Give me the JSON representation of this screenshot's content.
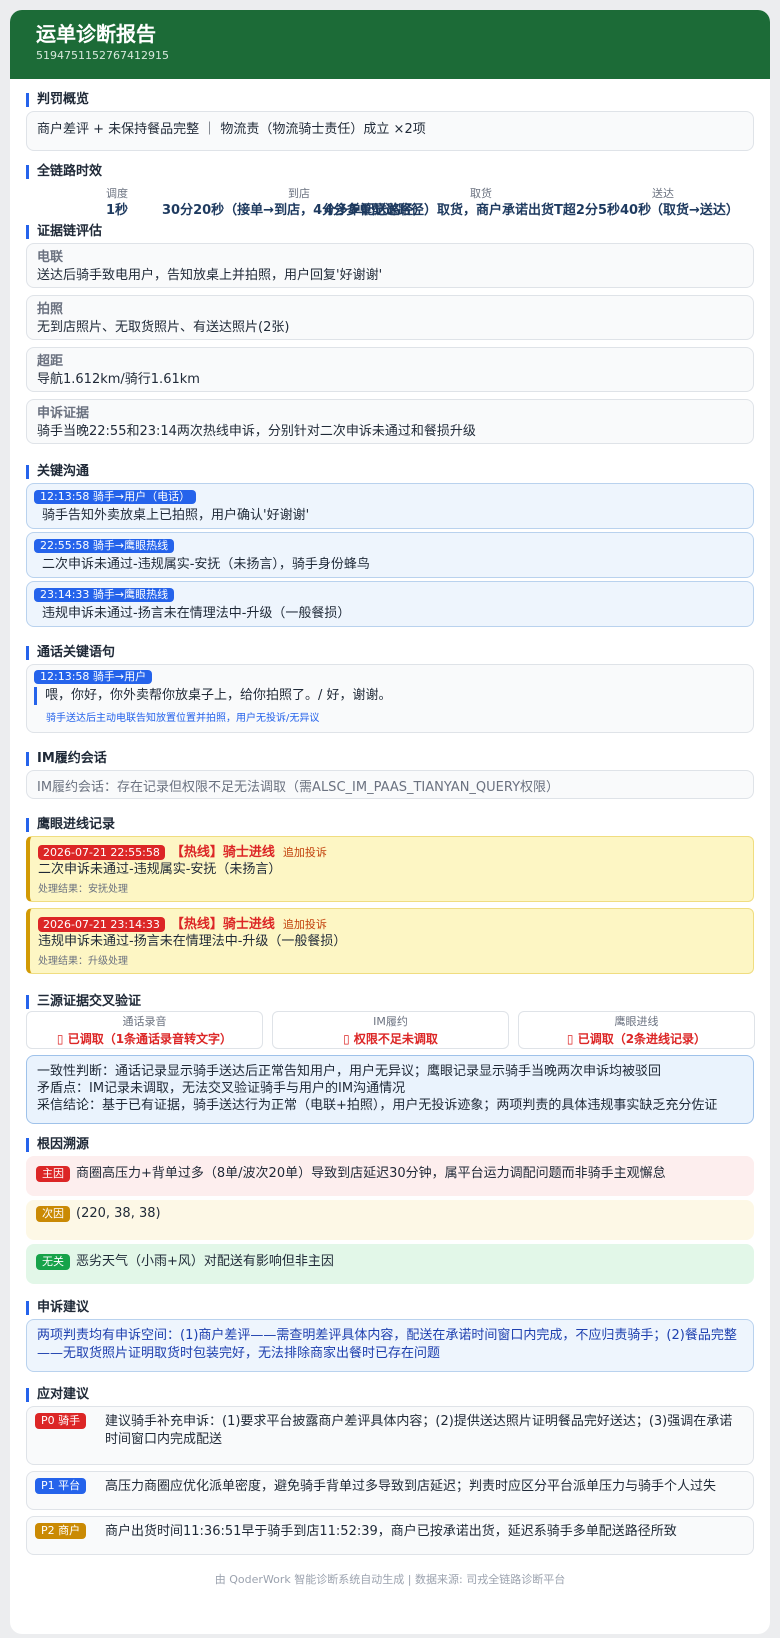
{
  "header": {
    "title": "运单诊断报告",
    "order_id": "5194751152767412915"
  },
  "penalty": {
    "title": "判罚概览",
    "text": "商户差评 + 未保持餐品完整 ｜ 物流责（物流骑士责任）成立 ×2项"
  },
  "timing": {
    "title": "全链路时效",
    "stages": [
      {
        "label": "调度",
        "value": "1秒"
      },
      {
        "label": "到店",
        "value": "30分20秒（接单→到店，4分多单配送路径）"
      },
      {
        "label": "取货",
        "value": "4分多单配送路径）取货，商户承诺出货T超2分5秒40秒"
      },
      {
        "label": "送达",
        "value": "（取货→送达）"
      }
    ]
  },
  "evidence": {
    "title": "证据链评估",
    "items": [
      {
        "label": "电联",
        "text": "送达后骑手致电用户，告知放桌上并拍照，用户回复'好谢谢'"
      },
      {
        "label": "拍照",
        "text": "无到店照片、无取货照片、有送达照片(2张)"
      },
      {
        "label": "超距",
        "text": "导航1.612km/骑行1.61km"
      },
      {
        "label": "申诉证据",
        "text": "骑手当晚22:55和23:14两次热线申诉，分别针对二次申诉未通过和餐损升级"
      }
    ]
  },
  "comms": {
    "title": "关键沟通",
    "items": [
      {
        "tag": "12:13:58  骑手→用户（电话）",
        "text": "骑手告知外卖放桌上已拍照，用户确认'好谢谢'"
      },
      {
        "tag": "22:55:58  骑手→鹰眼热线",
        "text": "二次申诉未通过-违规属实-安抚（未扬言），骑手身份蜂鸟"
      },
      {
        "tag": "23:14:33  骑手→鹰眼热线",
        "text": "违规申诉未通过-扬言未在情理法中-升级（一般餐损）"
      }
    ]
  },
  "call": {
    "title": "通话关键语句",
    "tag": "12:13:58  骑手→用户",
    "quote": "喂，你好，你外卖帮你放桌子上，给你拍照了。/ 好，谢谢。",
    "note": "骑手送达后主动电联告知放置位置并拍照，用户无投诉/无异议"
  },
  "im": {
    "title": "IM履约会话",
    "text": "IM履约会话：存在记录但权限不足无法调取（需ALSC_IM_PAAS_TIANYAN_QUERY权限）"
  },
  "eagle": {
    "title": "鹰眼进线记录",
    "items": [
      {
        "time": "2026-07-21 22:55:58",
        "type": "【热线】骑士进线",
        "extra": "追加投诉",
        "text": "二次申诉未通过-违规属实-安抚（未扬言）",
        "result": "处理结果：安抚处理"
      },
      {
        "time": "2026-07-21 23:14:33",
        "type": "【热线】骑士进线",
        "extra": "追加投诉",
        "text": "违规申诉未通过-扬言未在情理法中-升级（一般餐损）",
        "result": "处理结果：升级处理"
      }
    ]
  },
  "cross": {
    "title": "三源证据交叉验证",
    "sources": [
      {
        "label": "通话录音",
        "value": "▯ 已调取（1条通话录音转文字）"
      },
      {
        "label": "IM履约",
        "value": "▯ 权限不足未调取"
      },
      {
        "label": "鹰眼进线",
        "value": "▯ 已调取（2条进线记录）"
      }
    ],
    "lines": [
      "一致性判断：通话记录显示骑手送达后正常告知用户，用户无异议；鹰眼记录显示骑手当晚两次申诉均被驳回",
      "矛盾点：IM记录未调取，无法交叉验证骑手与用户的IM沟通情况",
      "采信结论：基于已有证据，骑手送达行为正常（电联+拍照），用户无投诉迹象；两项判责的具体违规事实缺乏充分佐证"
    ]
  },
  "root": {
    "title": "根因溯源",
    "items": [
      {
        "tag": "主因",
        "text": "商圈高压力+背单过多（8单/波次20单）导致到店延迟30分钟，属平台运力调配问题而非骑手主观懈怠",
        "color": "#dc2626",
        "bg": "#fdeeee"
      },
      {
        "tag": "次因",
        "text": "(220, 38, 38)",
        "color": "#ca8a04",
        "bg": "#fdf8e6"
      },
      {
        "tag": "无关",
        "text": "恶劣天气（小雨+风）对配送有影响但非主因",
        "color": "#16a34a",
        "bg": "#e2f7e8"
      }
    ]
  },
  "appeal": {
    "title": "申诉建议",
    "text": "两项判责均有申诉空间：(1)商户差评——需查明差评具体内容，配送在承诺时间窗口内完成，不应归责骑手；(2)餐品完整——无取货照片证明取货时包装完好，无法排除商家出餐时已存在问题"
  },
  "response": {
    "title": "应对建议",
    "items": [
      {
        "tag": "P0 骑手",
        "color": "#dc2626",
        "text": "建议骑手补充申诉：(1)要求平台披露商户差评具体内容；(2)提供送达照片证明餐品完好送达；(3)强调在承诺时间窗口内完成配送"
      },
      {
        "tag": "P1 平台",
        "color": "#2563eb",
        "text": "高压力商圈应优化派单密度，避免骑手背单过多导致到店延迟；判责时应区分平台派单压力与骑手个人过失"
      },
      {
        "tag": "P2 商户",
        "color": "#ca8a04",
        "text": "商户出货时间11:36:51早于骑手到店11:52:39，商户已按承诺出货，延迟系骑手多单配送路径所致"
      }
    ]
  },
  "footer": "由 QoderWork 智能诊断系统自动生成 | 数据来源: 司戎全链路诊断平台"
}
